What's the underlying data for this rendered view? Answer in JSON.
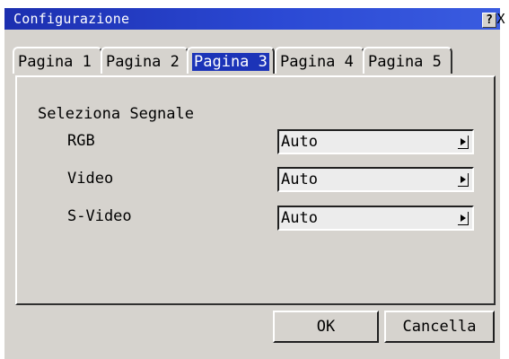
{
  "window": {
    "title": "Configurazione",
    "help_label": "?",
    "close_label": "X"
  },
  "tabs": [
    {
      "label": "Pagina 1"
    },
    {
      "label": "Pagina 2"
    },
    {
      "label": "Pagina 3",
      "active": true
    },
    {
      "label": "Pagina 4"
    },
    {
      "label": "Pagina 5"
    }
  ],
  "section": {
    "title": "Seleziona Segnale"
  },
  "rows": [
    {
      "label": "RGB",
      "value": "Auto"
    },
    {
      "label": "Video",
      "value": "Auto"
    },
    {
      "label": "S-Video",
      "value": "Auto"
    }
  ],
  "buttons": {
    "ok": "OK",
    "cancel": "Cancella"
  },
  "colors": {
    "title_bar": "#1c2fb0",
    "dialog_bg": "#d6d3ce",
    "active_tab_highlight": "#1c34b8"
  }
}
